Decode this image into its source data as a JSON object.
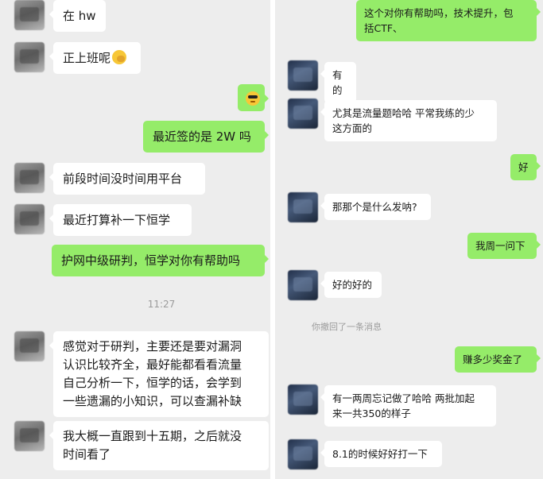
{
  "left_chat": {
    "msg_1": "在 hw",
    "msg_2": "正上班呢",
    "msg_2_emoji": "facepalm-emoji",
    "msg_3_emoji": "sunglasses-emoji",
    "msg_4": "最近签的是 2W 吗",
    "msg_5": "前段时间没时间用平台",
    "msg_6": "最近打算补一下恒学",
    "msg_7": "护网中级研判，恒学对你有帮助吗",
    "time_1": "11:27",
    "msg_8": "感觉对于研判，主要还是要对漏洞\n认识比较齐全，最好能都看看流量\n自己分析一下，恒学的话，会学到\n一些遗漏的小知识，可以查漏补缺",
    "msg_9": "我大概一直跟到十五期，之后就没\n时间看了"
  },
  "right_chat": {
    "msg_1": "这个对你有帮助吗，技术提升，包\n括CTF、",
    "msg_2": "有的",
    "msg_3": "尤其是流量题哈哈 平常我练的少\n这方面的",
    "msg_4": "好",
    "msg_5": "那那个是什么发呐?",
    "msg_6": "我周一问下",
    "msg_7": "好的好的",
    "system_1": "你撤回了一条消息",
    "msg_8": "赚多少奖金了",
    "msg_9": "有一两周忘记做了哈哈 两批加起\n来一共350的样子",
    "msg_10": "8.1的时候好好打一下"
  },
  "colors": {
    "outgoing_bubble": "#95ec69",
    "incoming_bubble": "#ffffff",
    "chat_background": "#ededed"
  }
}
